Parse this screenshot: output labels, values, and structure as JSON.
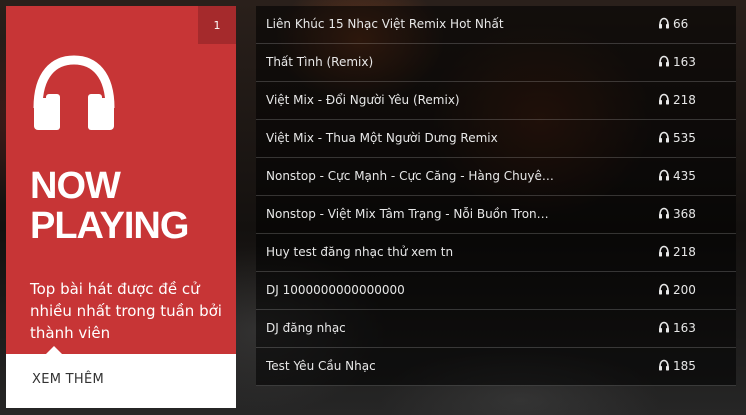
{
  "card": {
    "index": "1",
    "icon": "headphones-icon",
    "title_line1": "NOW",
    "title_line2": "PLAYING",
    "description": "Top bài hát được đề cử nhiều nhất trong tuần bởi thành viên",
    "more_label": "XEM THÊM",
    "accent_color": "#c73536"
  },
  "songs": [
    {
      "title": "Liên Khúc 15 Nhạc Việt Remix Hot Nhất",
      "count": "66"
    },
    {
      "title": "Thất Tình (Remix)",
      "count": "163"
    },
    {
      "title": "Việt Mix - Đổi Người Yêu (Remix)",
      "count": "218"
    },
    {
      "title": "Việt Mix - Thua Một Người Dưng Remix",
      "count": "535"
    },
    {
      "title": "Nonstop - Cực Mạnh - Cực Căng - Hàng Chuyên...",
      "count": "435"
    },
    {
      "title": "Nonstop - Việt Mix Tâm Trạng - Nỗi Buồn Trong ...",
      "count": "368"
    },
    {
      "title": "Huy test đăng nhạc thử xem tn",
      "count": "218"
    },
    {
      "title": "DJ 1000000000000000",
      "count": "200"
    },
    {
      "title": "DJ đăng nhạc",
      "count": "163"
    },
    {
      "title": "Test Yêu Cầu Nhạc",
      "count": "185"
    }
  ],
  "count_icon": "headphones-icon"
}
